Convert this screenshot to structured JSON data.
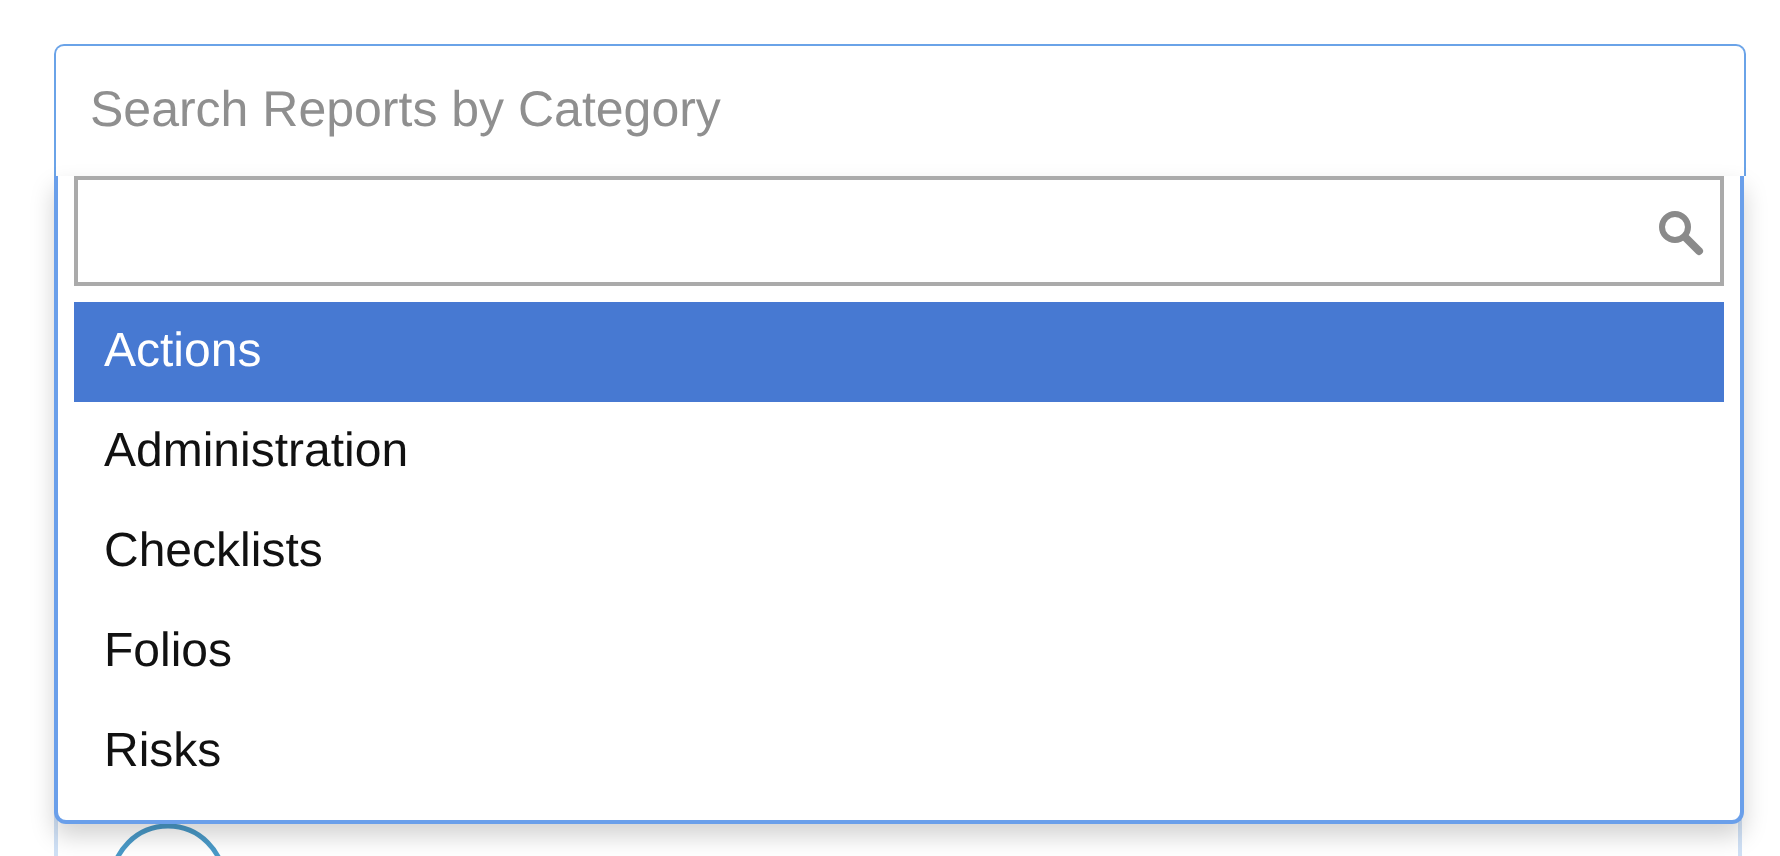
{
  "select": {
    "placeholder": "Search Reports by Category"
  },
  "dropdown": {
    "options": [
      {
        "label": "Actions",
        "selected": true
      },
      {
        "label": "Administration",
        "selected": false
      },
      {
        "label": "Checklists",
        "selected": false
      },
      {
        "label": "Folios",
        "selected": false
      },
      {
        "label": "Risks",
        "selected": false
      }
    ]
  }
}
